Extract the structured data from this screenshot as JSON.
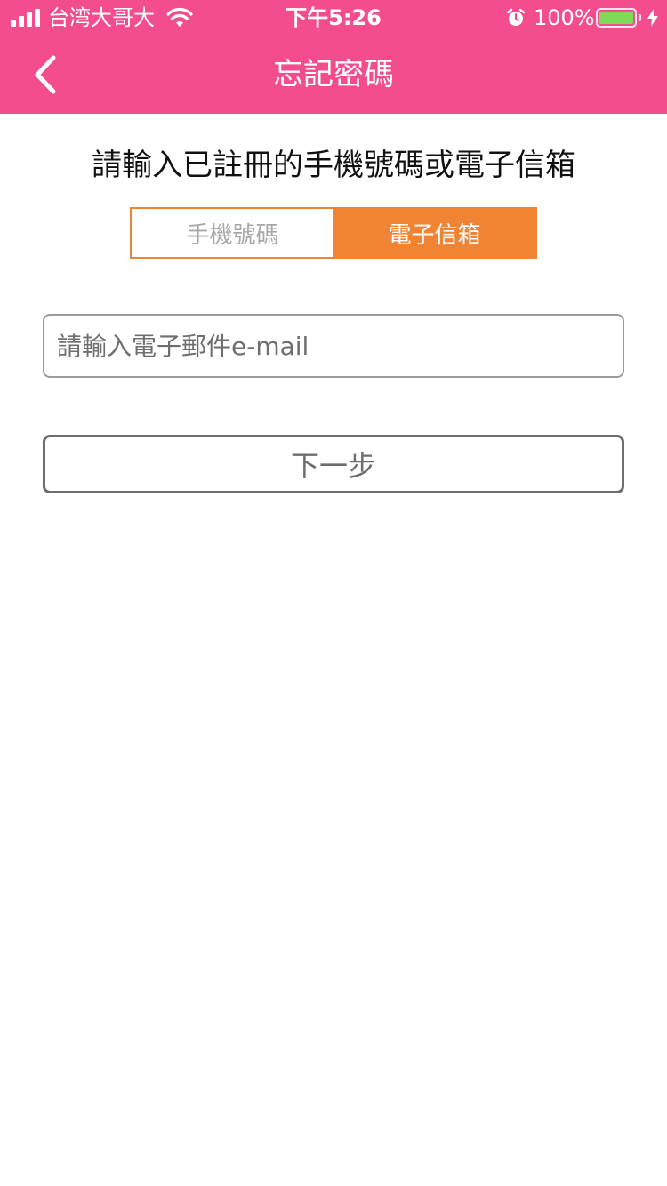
{
  "status_bar": {
    "carrier": "台湾大哥大",
    "time": "下午5:26",
    "battery_percent": "100%",
    "battery_level": 1.0,
    "icons": [
      "signal-icon",
      "wifi-icon",
      "alarm-icon",
      "battery-icon",
      "charging-icon"
    ]
  },
  "nav": {
    "title": "忘記密碼",
    "back_icon": "chevron-left-icon"
  },
  "form": {
    "instruction": "請輸入已註冊的手機號碼或電子信箱",
    "tabs": [
      {
        "label": "手機號碼",
        "selected": false
      },
      {
        "label": "電子信箱",
        "selected": true
      }
    ],
    "email_value": "",
    "email_placeholder": "請輸入電子郵件e-mail",
    "next_label": "下一步"
  },
  "colors": {
    "header_bg": "#f34d8e",
    "accent_orange": "#f08433",
    "battery_green": "#7ed957"
  }
}
